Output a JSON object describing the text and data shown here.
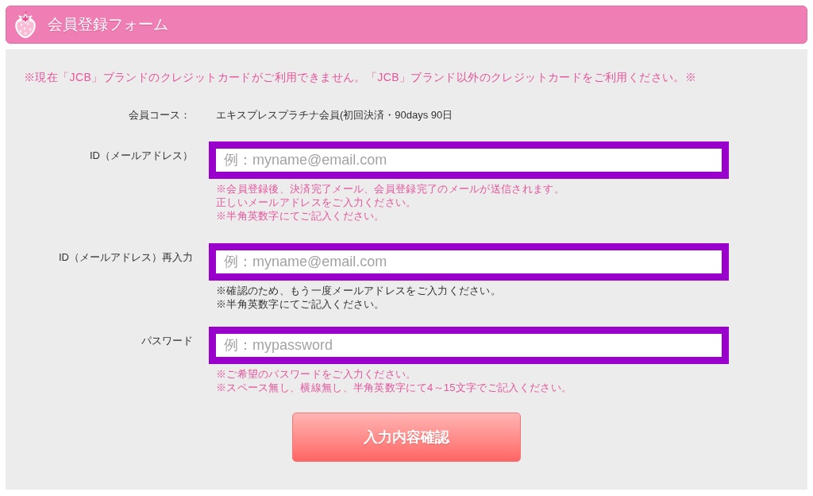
{
  "header": {
    "title": "会員登録フォーム"
  },
  "notice": "※現在「JCB」ブランドのクレジットカードがご利用できません。「JCB」ブランド以外のクレジットカードをご利用ください。※",
  "course": {
    "label": "会員コース：",
    "value": "エキスプレスプラチナ会員(初回決済・90days 90日"
  },
  "fields": [
    {
      "label": "ID（メールアドレス）",
      "placeholder": "例：myname@email.com",
      "kind": "warning",
      "notes": [
        "※会員登録後、決済完了メール、会員登録完了のメールが送信されます。",
        "正しいメールアドレスをご入力ください。",
        "※半角英数字にてご記入ください。"
      ]
    },
    {
      "label": "ID（メールアドレス）再入力",
      "placeholder": "例：myname@email.com",
      "kind": "info",
      "notes": [
        "※確認のため、もう一度メールアドレスをご入力ください。",
        "※半角英数字にてご記入ください。"
      ]
    },
    {
      "label": "パスワード",
      "placeholder": "例：mypassword",
      "kind": "warning",
      "notes": [
        "※ご希望のパスワードをご入力ください。",
        "※スペース無し、横線無し、半角英数字にて4～15文字でご記入ください。"
      ]
    }
  ],
  "submit_button": "入力内容確認"
}
